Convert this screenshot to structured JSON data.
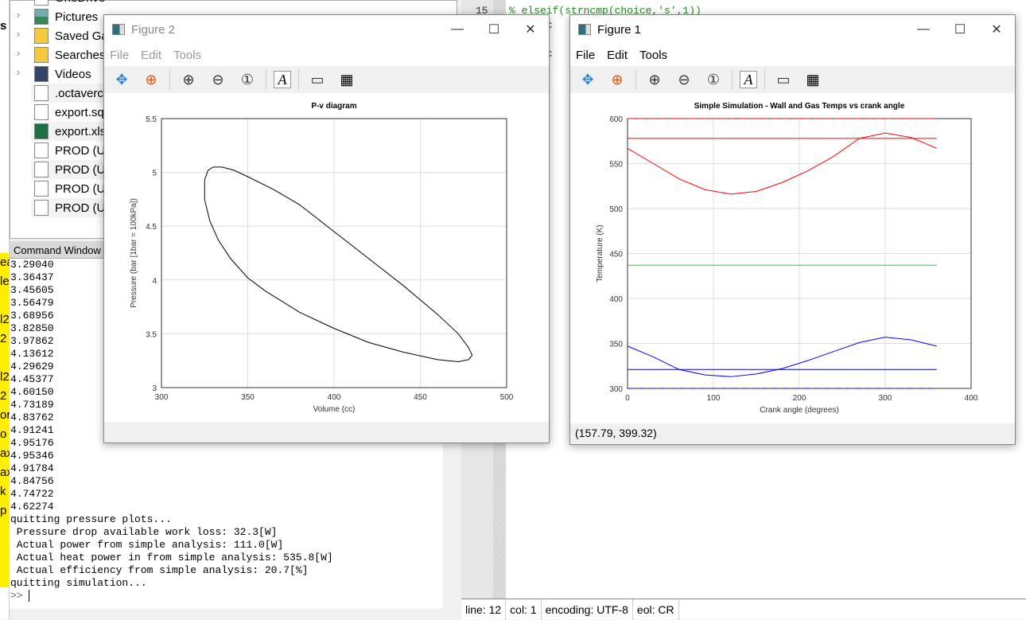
{
  "left_fragments": {
    "top": "s",
    "yellow": [
      "ea",
      "le",
      "",
      "l2",
      "2",
      "",
      "l2",
      "2",
      "or",
      "o",
      "ax",
      "ax",
      "k",
      "p"
    ]
  },
  "file_browser": {
    "items": [
      {
        "label": "OneDrive",
        "expandable": true
      },
      {
        "label": "Pictures",
        "expandable": true
      },
      {
        "label": "Saved Ga",
        "expandable": true
      },
      {
        "label": "Searches",
        "expandable": true
      },
      {
        "label": "Videos",
        "expandable": true
      },
      {
        "label": ".octaverc",
        "expandable": false
      },
      {
        "label": "export.sq",
        "expandable": false
      },
      {
        "label": "export.xls",
        "expandable": false
      },
      {
        "label": "PROD (Ur",
        "expandable": false
      },
      {
        "label": "PROD (Ur",
        "expandable": false
      },
      {
        "label": "PROD (Ur",
        "expandable": false
      },
      {
        "label": "PROD (Ur",
        "expandable": false
      }
    ]
  },
  "command_window": {
    "title": "Command Window",
    "lines": [
      "3.29040",
      "3.36437",
      "3.45605",
      "3.56479",
      "3.68956",
      "3.82850",
      "3.97862",
      "4.13612",
      "4.29629",
      "4.45377",
      "4.60150",
      "4.73189",
      "4.83762",
      "4.91241",
      "4.95176",
      "4.95346",
      "4.91784",
      "4.84756",
      "4.74722",
      "4.62274",
      "quitting pressure plots...",
      " Pressure drop available work loss: 32.3[W]",
      " Actual power from simple analysis: 111.0[W]",
      " Actual heat power in from simple analysis: 535.8[W]",
      " Actual efficiency from simple analysis: 20.7[%]",
      "quitting simulation..."
    ],
    "prompt": ">> "
  },
  "editor": {
    "line_number": "15",
    "code_lines": [
      "% elseif(strncmp(choice,'s',1))",
      "   ar,c",
      "",
      "   f('c"
    ]
  },
  "status_bar": {
    "line_label": "line:",
    "line": "12",
    "col_label": "col:",
    "col": "1",
    "encoding_label": "encoding:",
    "encoding": "UTF-8",
    "eol_label": "eol:",
    "eol": "CR"
  },
  "figure2": {
    "title": "Figure 2",
    "menu": [
      "File",
      "Edit",
      "Tools"
    ]
  },
  "figure1": {
    "title": "Figure 1",
    "menu": [
      "File",
      "Edit",
      "Tools"
    ],
    "coords": "(157.79, 399.32)"
  },
  "toolbar_icons": [
    "pan-icon",
    "rotate-icon",
    "zoom-in-icon",
    "zoom-out-icon",
    "zoom-reset-icon",
    "text-icon",
    "legend-icon",
    "grid-icon"
  ],
  "chart_data": [
    {
      "type": "line",
      "title": "P-v diagram",
      "xlabel": "Volume (cc)",
      "ylabel": "Pressure (bar [1bar = 100kPa])",
      "xlim": [
        300,
        500
      ],
      "ylim": [
        3,
        5.5
      ],
      "xticks": [
        300,
        350,
        400,
        450,
        500
      ],
      "yticks": [
        3,
        3.5,
        4,
        4.5,
        5,
        5.5
      ],
      "grid": true,
      "series": [
        {
          "color": "#000000",
          "x": [
            325,
            327,
            330,
            335,
            342,
            350,
            365,
            380,
            400,
            420,
            440,
            460,
            472,
            478,
            480,
            478,
            472,
            460,
            440,
            420,
            400,
            380,
            360,
            350,
            340,
            333,
            328,
            325,
            325
          ],
          "y": [
            4.93,
            5.02,
            5.05,
            5.05,
            5.02,
            4.96,
            4.84,
            4.7,
            4.45,
            4.2,
            3.95,
            3.68,
            3.5,
            3.37,
            3.3,
            3.26,
            3.24,
            3.26,
            3.33,
            3.42,
            3.55,
            3.7,
            3.9,
            4.02,
            4.2,
            4.37,
            4.55,
            4.75,
            4.93
          ]
        }
      ]
    },
    {
      "type": "line",
      "title": "Simple Simulation - Wall and Gas Temps vs crank angle",
      "xlabel": "Crank angle (degrees)",
      "ylabel": "Temperature (K)",
      "xlim": [
        0,
        400
      ],
      "ylim": [
        300,
        600
      ],
      "xticks": [
        0,
        100,
        200,
        300,
        400
      ],
      "yticks": [
        300,
        350,
        400,
        450,
        500,
        550,
        600
      ],
      "grid": true,
      "series": [
        {
          "color": "#ff0000",
          "x": [
            0,
            30,
            60,
            90,
            120,
            150,
            180,
            210,
            240,
            270,
            300,
            330,
            360
          ],
          "y": [
            567,
            550,
            533,
            521,
            516,
            519,
            529,
            542,
            558,
            578,
            584,
            579,
            567
          ]
        },
        {
          "color": "#ff0000",
          "x": [
            0,
            360
          ],
          "y": [
            578,
            578
          ]
        },
        {
          "color": "#ff0000",
          "dashed": true,
          "x": [
            0,
            360
          ],
          "y": [
            600,
            600
          ]
        },
        {
          "color": "#00ee00",
          "x": [
            0,
            360
          ],
          "y": [
            437,
            437
          ]
        },
        {
          "color": "#0000ff",
          "x": [
            0,
            30,
            60,
            90,
            120,
            150,
            180,
            210,
            240,
            270,
            300,
            330,
            360
          ],
          "y": [
            347,
            335,
            321,
            315,
            313,
            316,
            322,
            331,
            341,
            351,
            357,
            354,
            347
          ]
        },
        {
          "color": "#0000cc",
          "x": [
            0,
            360
          ],
          "y": [
            321,
            321
          ]
        },
        {
          "color": "#0000ff",
          "dashed": true,
          "x": [
            0,
            360
          ],
          "y": [
            300,
            300
          ]
        }
      ]
    }
  ]
}
